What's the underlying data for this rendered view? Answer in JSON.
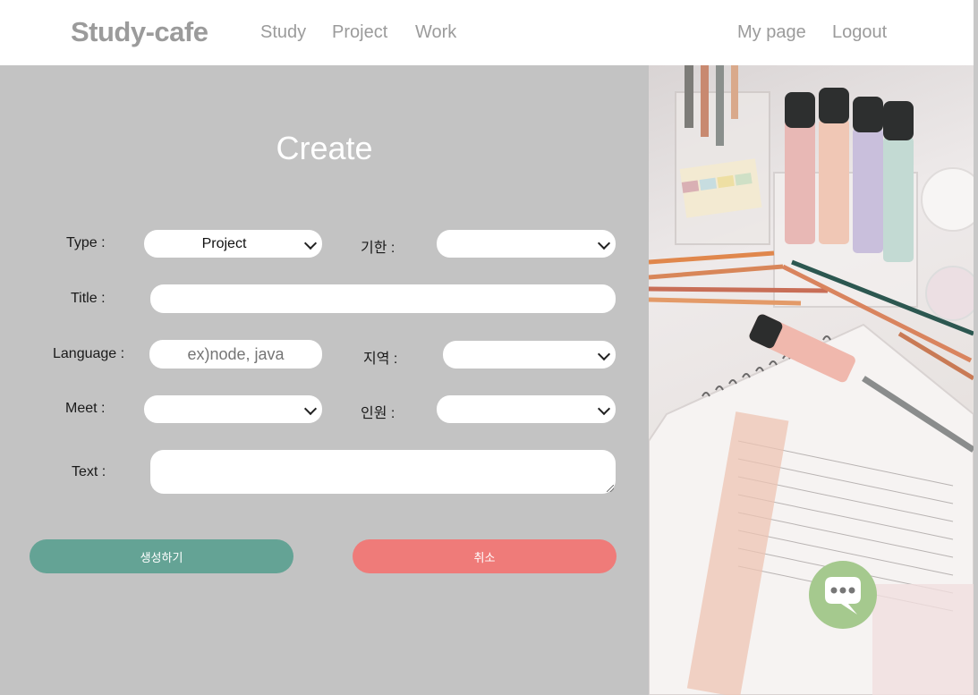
{
  "header": {
    "brand": "Study-cafe",
    "nav": [
      "Study",
      "Project",
      "Work"
    ],
    "user_nav": [
      "My page",
      "Logout"
    ]
  },
  "form": {
    "title": "Create",
    "type_label": "Type :",
    "type_value": "Project",
    "deadline_label": "기한 :",
    "deadline_value": "",
    "title_label": "Title :",
    "title_value": "",
    "language_label": "Language :",
    "language_placeholder": "ex)node, java",
    "region_label": "지역 :",
    "region_value": "",
    "meet_label": "Meet :",
    "meet_value": "",
    "members_label": "인원 :",
    "members_value": "",
    "text_label": "Text :",
    "text_value": "",
    "create_button": "생성하기",
    "cancel_button": "취소"
  },
  "colors": {
    "panel_bg": "#c3c3c3",
    "create_button": "#64a395",
    "cancel_button": "#ef7b79",
    "chat_button": "#a5c98e"
  },
  "icons": {
    "chat": "chat-bubble-icon"
  }
}
